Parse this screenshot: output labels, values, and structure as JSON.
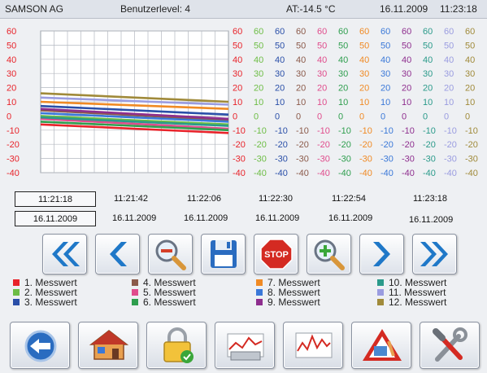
{
  "status_bar": {
    "company": "SAMSON AG",
    "user_level": "Benutzerlevel:  4",
    "outside_temp": "AT:-14.5 °C",
    "date": "16.11.2009",
    "time": "11:23:18"
  },
  "chart_data": {
    "type": "line",
    "title": "",
    "ylim": [
      -40,
      60
    ],
    "y_ticks": [
      "60",
      "50",
      "40",
      "30",
      "20",
      "10",
      "0",
      "-10",
      "-20",
      "-30",
      "-40"
    ],
    "grid": true,
    "axis_colors": [
      "#e8232a",
      "#6dbd45",
      "#2a4fa8",
      "#8b5a4a",
      "#e04c8c",
      "#2e9e4e",
      "#f08a24",
      "#3a78d8",
      "#8e2e8e",
      "#2a9a8a",
      "#9a9ce0",
      "#a08a3a"
    ],
    "series": [
      {
        "label": "1. Messwert",
        "color": "#e8232a",
        "values": [
          -6,
          -12
        ]
      },
      {
        "label": "2. Messwert",
        "color": "#6dbd45",
        "values": [
          0,
          -6
        ]
      },
      {
        "label": "3. Messwert",
        "color": "#2a4fa8",
        "values": [
          7,
          1
        ]
      },
      {
        "label": "4. Messwert",
        "color": "#8b5a4a",
        "values": [
          4,
          -3
        ]
      },
      {
        "label": "5. Messwert",
        "color": "#e04c8c",
        "values": [
          -2,
          -9
        ]
      },
      {
        "label": "6. Messwert",
        "color": "#2e9e4e",
        "values": [
          -4,
          -10
        ]
      },
      {
        "label": "7. Messwert",
        "color": "#f08a24",
        "values": [
          10,
          5
        ]
      },
      {
        "label": "8. Messwert",
        "color": "#3a78d8",
        "values": [
          2,
          -4
        ]
      },
      {
        "label": "9. Messwert",
        "color": "#8e2e8e",
        "values": [
          5,
          -2
        ]
      },
      {
        "label": "10. Messwert",
        "color": "#2a9a8a",
        "values": [
          -1,
          -7
        ]
      },
      {
        "label": "11. Messwert",
        "color": "#9a9ce0",
        "values": [
          13,
          8
        ]
      },
      {
        "label": "12. Messwert",
        "color": "#a08a3a",
        "values": [
          16,
          10
        ]
      }
    ]
  },
  "time_axis": {
    "times": [
      "11:21:18",
      "11:21:42",
      "11:22:06",
      "11:22:30",
      "11:22:54",
      "11:23:18"
    ],
    "dates": [
      "16.11.2009",
      "16.11.2009",
      "16.11.2009",
      "16.11.2009",
      "16.11.2009",
      "16.11.2009"
    ]
  },
  "nav_buttons": {
    "stop_label": "STOP"
  },
  "icons": [
    "double-left-arrow-icon",
    "left-arrow-icon",
    "zoom-out-icon",
    "save-disk-icon",
    "stop-sign-icon",
    "zoom-in-icon",
    "right-arrow-icon",
    "double-right-arrow-icon",
    "back-arrow-icon",
    "home-icon",
    "lock-icon",
    "controller-trend-icon",
    "trend-chart-icon",
    "warning-alarm-icon",
    "tools-icon"
  ]
}
